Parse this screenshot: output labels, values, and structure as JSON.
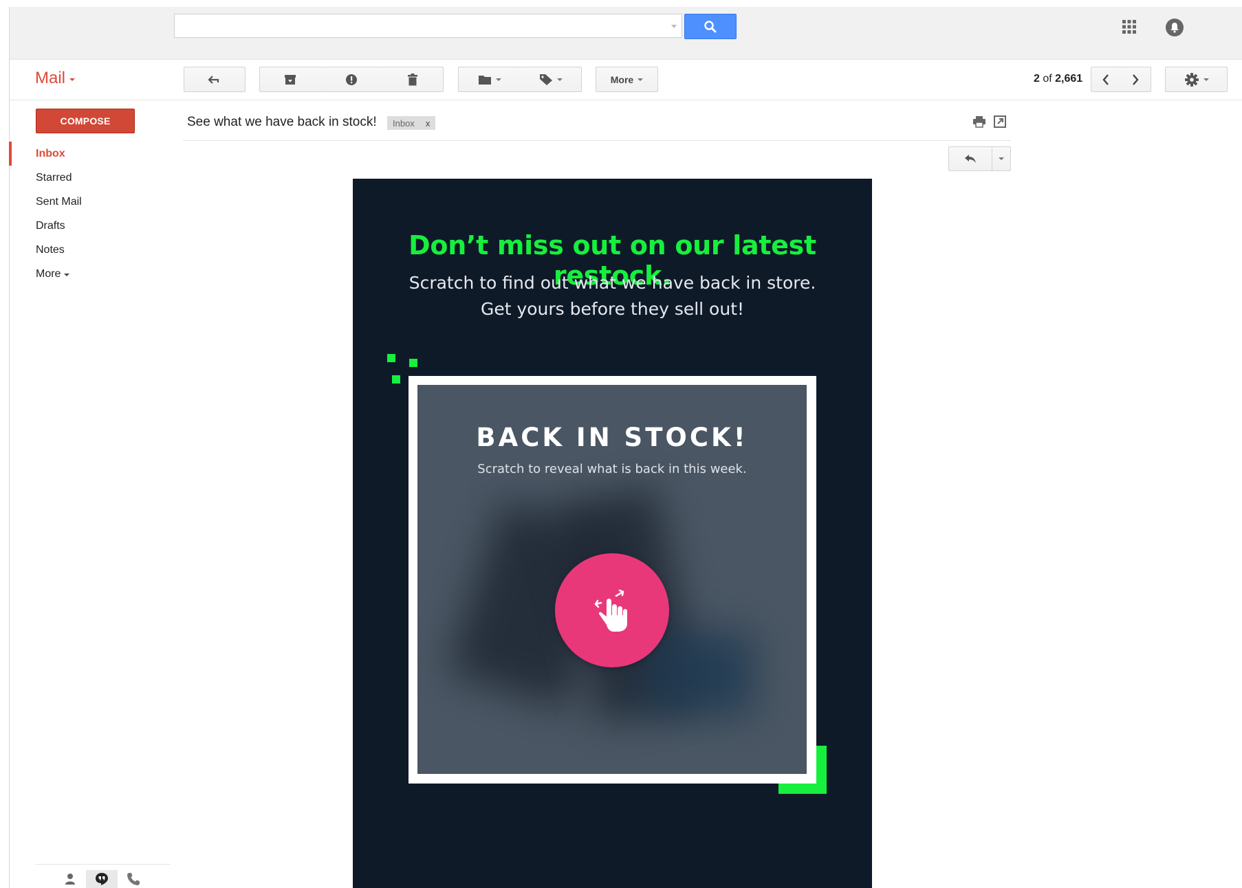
{
  "search": {
    "value": "",
    "placeholder": ""
  },
  "header": {
    "mail_label": "Mail"
  },
  "toolbar": {
    "back_icon": "back-arrow-icon",
    "archive_icon": "archive-icon",
    "spam_icon": "report-spam-icon",
    "delete_icon": "trash-icon",
    "move_icon": "folder-icon",
    "labels_icon": "tag-icon",
    "more_label": "More"
  },
  "pager": {
    "current": "2",
    "of_text": "of",
    "total": "2,661"
  },
  "sidebar": {
    "compose_label": "COMPOSE",
    "items": [
      {
        "label": "Inbox",
        "active": true
      },
      {
        "label": "Starred"
      },
      {
        "label": "Sent Mail"
      },
      {
        "label": "Drafts"
      },
      {
        "label": "Notes"
      },
      {
        "label": "More"
      }
    ]
  },
  "message": {
    "subject": "See what we have back in stock!",
    "label_chip": "Inbox",
    "label_remove": "x"
  },
  "email": {
    "headline": "Don’t miss out on our latest restock.",
    "subline_1": "Scratch to find out what we have back in store.",
    "subline_2": "Get yours before they sell out!",
    "card_title": "BACK IN STOCK!",
    "card_subtitle": "Scratch to reveal what is back in this week.",
    "scratch_icon": "scratch-hand-icon"
  },
  "colors": {
    "accent_red": "#dd4b39",
    "search_blue": "#4d90fe",
    "email_bg": "#0f1a29",
    "email_green": "#17ef3e",
    "scratch_pink": "#e8387a"
  }
}
